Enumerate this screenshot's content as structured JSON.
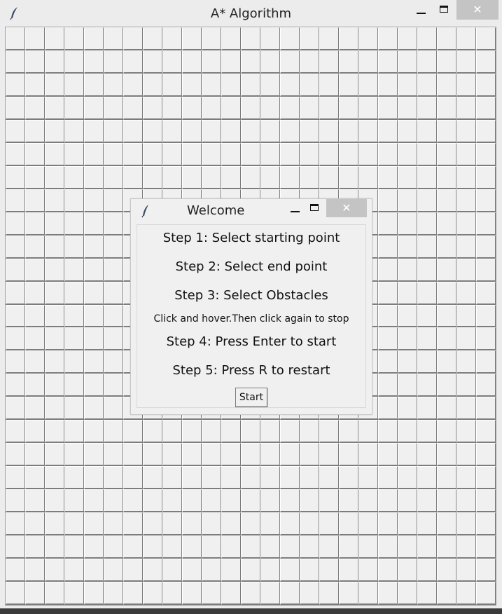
{
  "window": {
    "title": "A* Algorithm",
    "icon": "feather-icon",
    "controls": {
      "minimize": "minimize-icon",
      "maximize": "maximize-icon",
      "close": "✕"
    }
  },
  "grid": {
    "rows": 25,
    "cols": 25
  },
  "dialog": {
    "title": "Welcome",
    "icon": "feather-icon",
    "close": "✕",
    "steps": [
      "Step 1: Select starting point",
      "Step 2: Select end point",
      "Step 3: Select Obstacles"
    ],
    "hint": "Click and hover.Then click again to stop",
    "steps_after": [
      "Step 4: Press Enter to start",
      "Step 5: Press R to restart"
    ],
    "start_label": "Start"
  },
  "colors": {
    "close_button": "#c4c4c4",
    "grid_line": "#7c7c7c",
    "background": "#f0f0f0"
  }
}
